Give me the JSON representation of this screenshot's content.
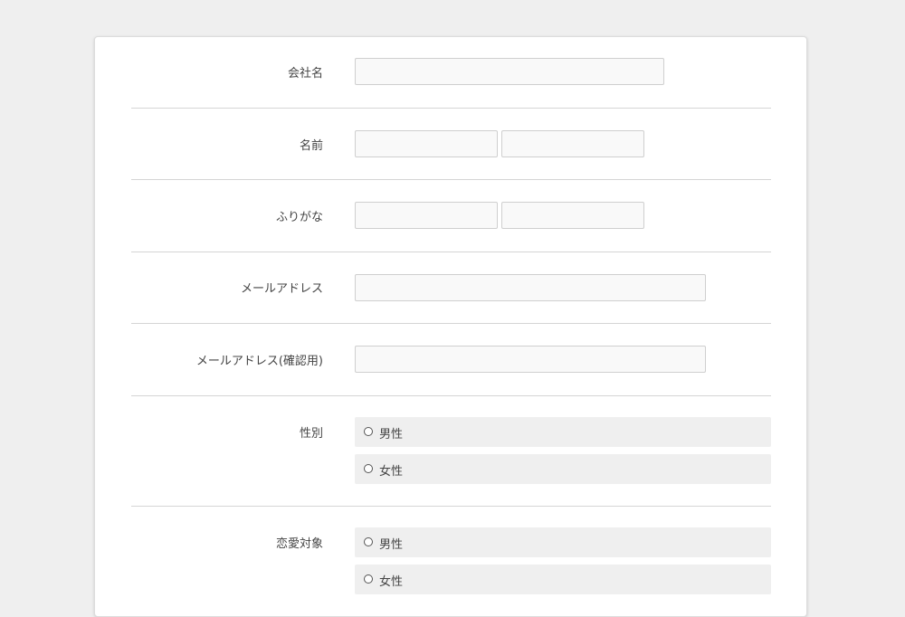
{
  "form": {
    "company": {
      "label": "会社名",
      "value": "",
      "placeholder": ""
    },
    "name": {
      "label": "名前",
      "last": "",
      "first": ""
    },
    "furigana": {
      "label": "ふりがな",
      "last": "",
      "first": ""
    },
    "email": {
      "label": "メールアドレス",
      "value": ""
    },
    "email_confirm": {
      "label": "メールアドレス(確認用)",
      "value": ""
    },
    "gender": {
      "label": "性別",
      "options": [
        {
          "label": "男性",
          "selected": false
        },
        {
          "label": "女性",
          "selected": false
        }
      ]
    },
    "romance_target": {
      "label": "恋愛対象",
      "options": [
        {
          "label": "男性",
          "selected": false
        },
        {
          "label": "女性",
          "selected": false
        }
      ]
    }
  },
  "colors": {
    "page_bg": "#efefef",
    "card_bg": "#ffffff",
    "input_bg": "#f9f9f9",
    "option_bg": "#efefef",
    "divider": "#d5d5d5"
  }
}
